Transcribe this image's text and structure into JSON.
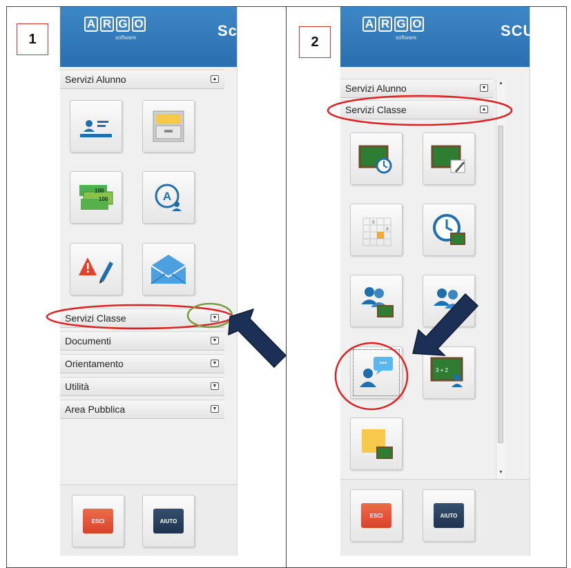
{
  "step_numbers": [
    "1",
    "2"
  ],
  "logo": {
    "letters": [
      "A",
      "R",
      "G",
      "O"
    ],
    "subtitle": "software",
    "header_cut_text_1": "Sc",
    "header_cut_text_2": "SCU"
  },
  "panel_1": {
    "sections": {
      "servizi_alunno": "Servizi Alunno",
      "servizi_classe": "Servizi Classe",
      "documenti": "Documenti",
      "orientamento": "Orientamento",
      "utilita": "Utilità",
      "area_pubblica": "Area Pubblica"
    },
    "tiles": [
      {
        "icon": "student-card-icon"
      },
      {
        "icon": "file-drawer-icon"
      },
      {
        "icon": "banknotes-icon",
        "note_value": "100"
      },
      {
        "icon": "grade-profile-icon",
        "letter": "A"
      },
      {
        "icon": "warning-edit-icon"
      },
      {
        "icon": "envelope-icon"
      }
    ],
    "footer": {
      "exit_label": "ESCI",
      "help_label": "AIUTO"
    }
  },
  "panel_2": {
    "sections": {
      "servizi_alunno": "Servizi Alunno",
      "servizi_classe": "Servizi Classe"
    },
    "tiles": [
      {
        "icon": "board-clock-icon"
      },
      {
        "icon": "board-edit-icon"
      },
      {
        "icon": "calendar-grid-icon",
        "digits": [
          "6",
          "8"
        ]
      },
      {
        "icon": "clock-board-icon"
      },
      {
        "icon": "group-board-icon"
      },
      {
        "icon": "group-icon"
      },
      {
        "icon": "teacher-chat-icon",
        "bubble_text": "•••"
      },
      {
        "icon": "board-math-icon",
        "board_text": "3 + 2"
      },
      {
        "icon": "sticky-note-board-icon"
      }
    ],
    "footer": {
      "exit_label": "ESCI",
      "help_label": "AIUTO"
    }
  },
  "colors": {
    "header_blue": "#2f78b8",
    "annotation_red": "#e02020",
    "annotation_green": "#7a9a3a",
    "arrow_navy": "#1c3056",
    "panel_bg": "#f0f0f0"
  }
}
